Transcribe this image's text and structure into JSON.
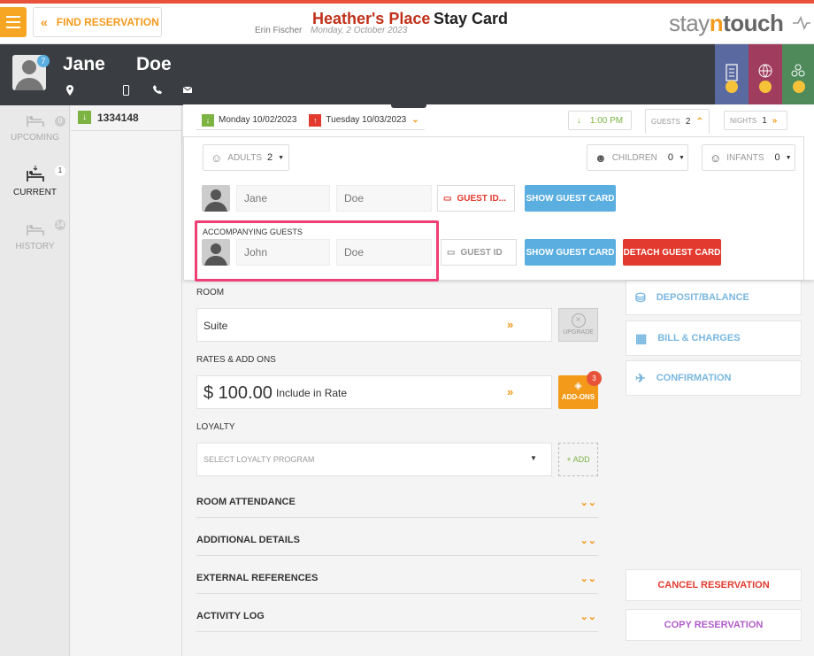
{
  "header": {
    "find_label": "FIND RESERVATION",
    "hotel_name": "Heather's Place",
    "card_title": "Stay Card",
    "user_name": "Erin Fischer",
    "business_date": "Monday, 2 October 2023",
    "logo_a": "stay",
    "logo_b": "n",
    "logo_c": "touch"
  },
  "guest": {
    "first_name": "Jane",
    "last_name": "Doe",
    "badge_count": "7",
    "icons": [
      "location-icon",
      "mobile-icon",
      "phone-icon",
      "email-icon"
    ]
  },
  "leftnav": {
    "items": [
      {
        "label": "UPCOMING",
        "count": "0"
      },
      {
        "label": "CURRENT",
        "count": "1"
      },
      {
        "label": "HISTORY",
        "count": "14"
      }
    ]
  },
  "reservation": {
    "number": "1334148"
  },
  "popup": {
    "arrival": "Monday 10/02/2023",
    "departure": "Tuesday 10/03/2023",
    "time": "1:00 PM",
    "guests_label": "GUESTS",
    "guests_count": "2",
    "nights_label": "NIGHTS",
    "nights_count": "1",
    "adults_label": "ADULTS",
    "adults_count": "2",
    "children_label": "CHILDREN",
    "children_count": "0",
    "infants_label": "INFANTS",
    "infants_count": "0",
    "primary_first": "Jane",
    "primary_last": "Doe",
    "guest_id_primary": "GUEST ID...",
    "show_guest_card": "SHOW GUEST CARD",
    "accompanying_label": "ACCOMPANYING GUESTS",
    "acc_first": "John",
    "acc_last": "Doe",
    "guest_id_acc": "GUEST ID",
    "detach_label": "DETACH GUEST CARD"
  },
  "main": {
    "room_label": "ROOM",
    "room_value": "Suite",
    "upgrade_label": "UPGRADE",
    "rates_label": "RATES & ADD ONS",
    "rate_amount": "$ 100.00",
    "rate_desc": "Include in Rate",
    "addons_label": "ADD-ONS",
    "addons_count": "3",
    "loyalty_label": "LOYALTY",
    "loyalty_placeholder": "SELECT LOYALTY PROGRAM",
    "loyalty_add": "+ ADD",
    "accordions": [
      "ROOM ATTENDANCE",
      "ADDITIONAL DETAILS",
      "EXTERNAL REFERENCES",
      "ACTIVITY LOG"
    ]
  },
  "right": {
    "deposit": "DEPOSIT/BALANCE",
    "bill": "BILL & CHARGES",
    "confirmation": "CONFIRMATION",
    "cancel": "CANCEL RESERVATION",
    "copy": "COPY RESERVATION"
  },
  "colors": {
    "accent_orange": "#f39a1b",
    "brand_red": "#c0311a",
    "highlight_pink": "#ef3f77",
    "blue_button": "#5aaee0",
    "red_button": "#e23a2e",
    "green": "#7cb342"
  }
}
